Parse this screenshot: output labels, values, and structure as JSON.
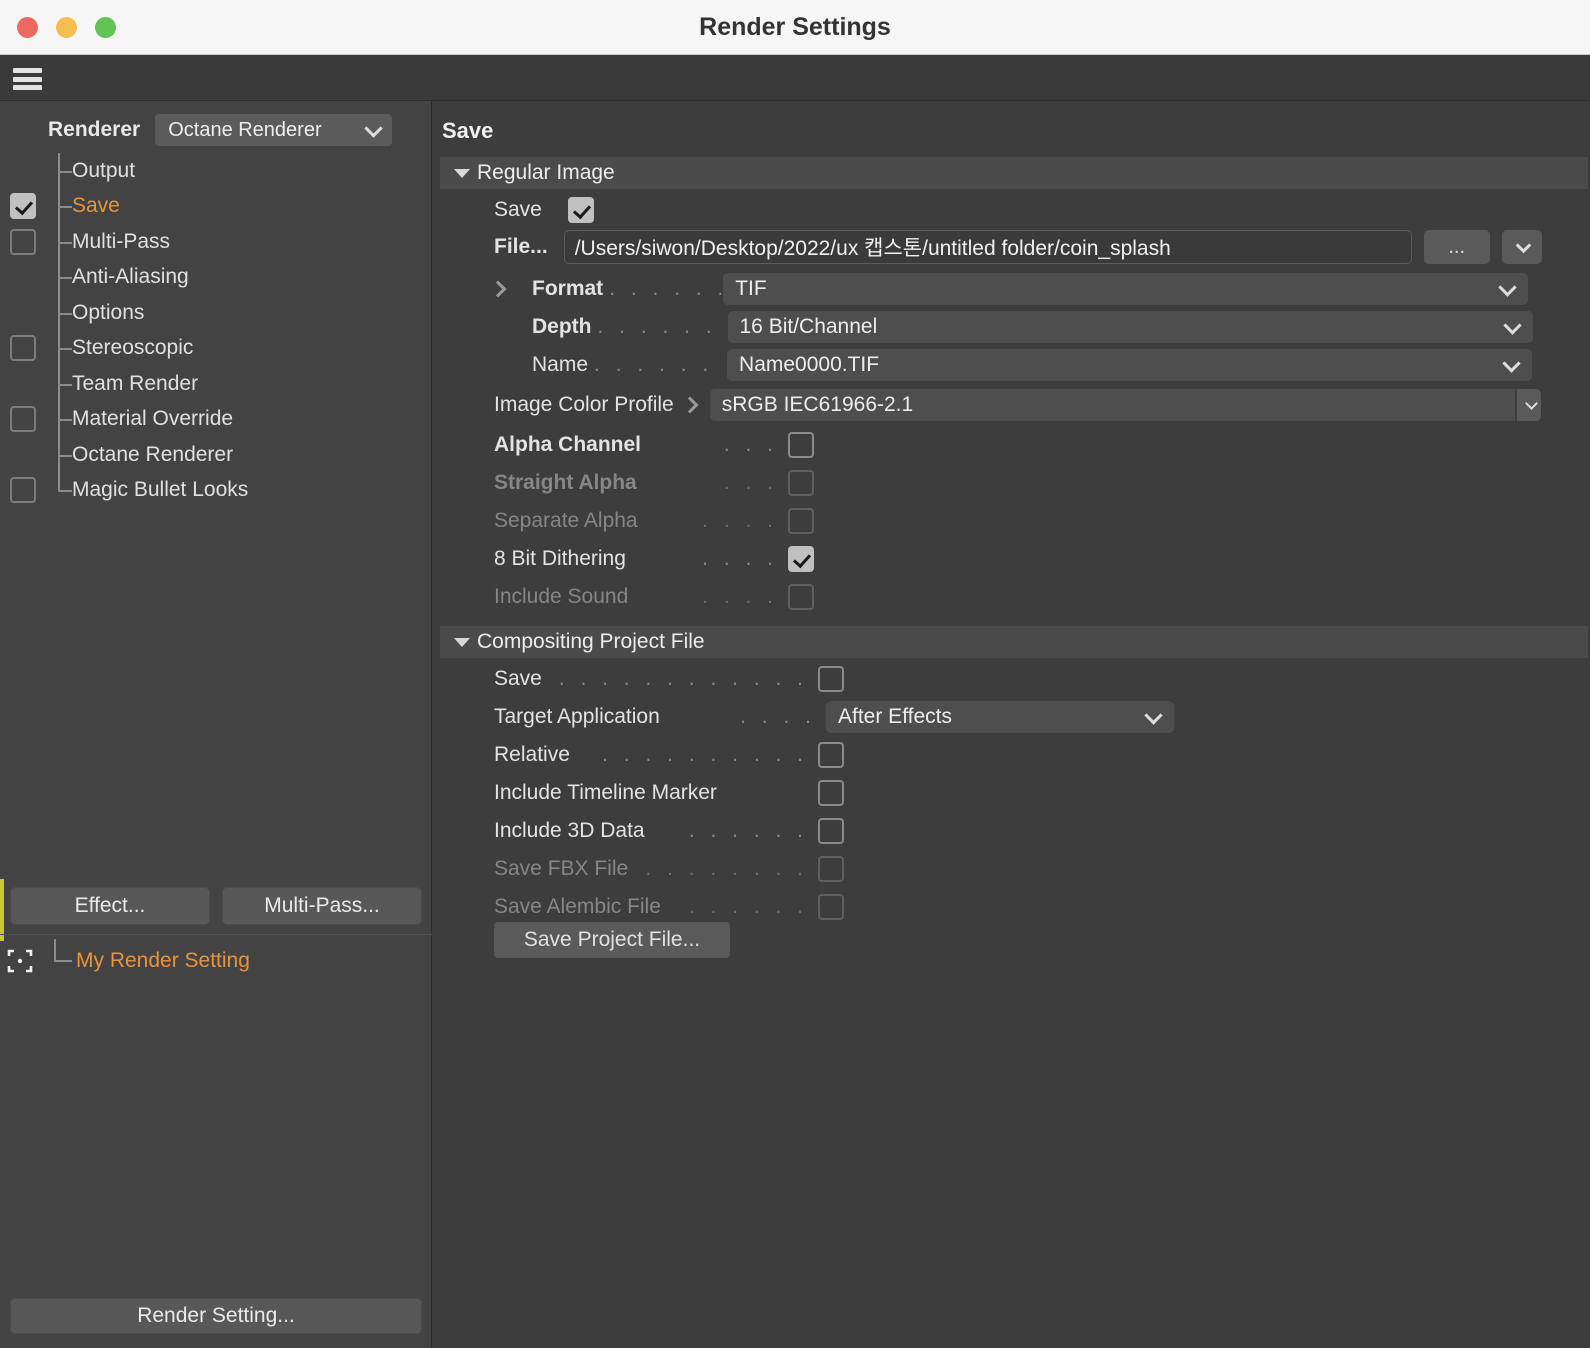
{
  "window": {
    "title": "Render Settings",
    "traffic_lights": [
      "close-button",
      "minimize-button",
      "zoom-button"
    ]
  },
  "toolbar": {
    "menu_icon": "hamburger-menu-icon"
  },
  "sidebar": {
    "renderer_label": "Renderer",
    "renderer_value": "Octane Renderer",
    "tree_items": [
      {
        "label": "Output",
        "checkbox": "none",
        "active": false
      },
      {
        "label": "Save",
        "checkbox": "checked",
        "active": true
      },
      {
        "label": "Multi-Pass",
        "checkbox": "unchecked",
        "active": false
      },
      {
        "label": "Anti-Aliasing",
        "checkbox": "none",
        "active": false
      },
      {
        "label": "Options",
        "checkbox": "none",
        "active": false
      },
      {
        "label": "Stereoscopic",
        "checkbox": "unchecked",
        "active": false
      },
      {
        "label": "Team Render",
        "checkbox": "none",
        "active": false
      },
      {
        "label": "Material Override",
        "checkbox": "unchecked",
        "active": false
      },
      {
        "label": "Octane Renderer",
        "checkbox": "none",
        "active": false
      },
      {
        "label": "Magic Bullet Looks",
        "checkbox": "unchecked",
        "active": false
      }
    ],
    "effect_button": "Effect...",
    "multipass_button": "Multi-Pass...",
    "preset_icon": "viewfinder-icon",
    "preset_label": "My Render Setting",
    "render_setting_button": "Render Setting..."
  },
  "main": {
    "title": "Save",
    "regular_image": {
      "header": "Regular Image",
      "save_label": "Save",
      "save_checked": true,
      "file_label": "File...",
      "file_value": "/Users/siwon/Desktop/2022/ux 캡스톤/untitled folder/coin_splash",
      "browse_button": "...",
      "format_label": "Format",
      "format_value": "TIF",
      "depth_label": "Depth",
      "depth_value": "16 Bit/Channel",
      "name_label": "Name",
      "name_value": "Name0000.TIF",
      "profile_label": "Image Color Profile",
      "profile_value": "sRGB IEC61966-2.1",
      "checkboxes": [
        {
          "label": "Alpha Channel",
          "dots": ". . .",
          "checked": false,
          "disabled": false,
          "bold": true
        },
        {
          "label": "Straight Alpha",
          "dots": ". . .",
          "checked": false,
          "disabled": true,
          "bold": true
        },
        {
          "label": "Separate Alpha",
          "dots": ". . . .",
          "checked": false,
          "disabled": true,
          "bold": false
        },
        {
          "label": "8 Bit Dithering",
          "dots": ". . . .",
          "checked": true,
          "disabled": false,
          "bold": false
        },
        {
          "label": "Include Sound",
          "dots": ". . . .",
          "checked": false,
          "disabled": true,
          "bold": false
        }
      ]
    },
    "compositing": {
      "header": "Compositing Project File",
      "rows": [
        {
          "label": "Save",
          "dots": ". . . . . . . . . . . .",
          "type": "checkbox",
          "checked": false,
          "disabled": false
        },
        {
          "label": "Target Application",
          "dots": ". . . .",
          "type": "select",
          "value": "After Effects",
          "disabled": false
        },
        {
          "label": "Relative",
          "dots": ". . . . . . . . . .",
          "type": "checkbox",
          "checked": false,
          "disabled": false
        },
        {
          "label": "Include Timeline Marker",
          "dots": "",
          "type": "checkbox",
          "checked": false,
          "disabled": false
        },
        {
          "label": "Include 3D Data",
          "dots": ". . . . . .",
          "type": "checkbox",
          "checked": false,
          "disabled": false
        },
        {
          "label": "Save FBX File",
          "dots": ". . . . . . . .",
          "type": "checkbox",
          "checked": false,
          "disabled": true
        },
        {
          "label": "Save Alembic File",
          "dots": ". . . . . .",
          "type": "checkbox",
          "checked": false,
          "disabled": true
        }
      ],
      "save_project_button": "Save Project File..."
    }
  },
  "colors": {
    "accent_orange": "#e8943c",
    "panel_bg": "#3d3d3d",
    "sidebar_bg": "#434343",
    "section_header_bg": "#4b4b4b",
    "field_bg": "#4e4e4e",
    "edge_strip": "#c8c832"
  }
}
